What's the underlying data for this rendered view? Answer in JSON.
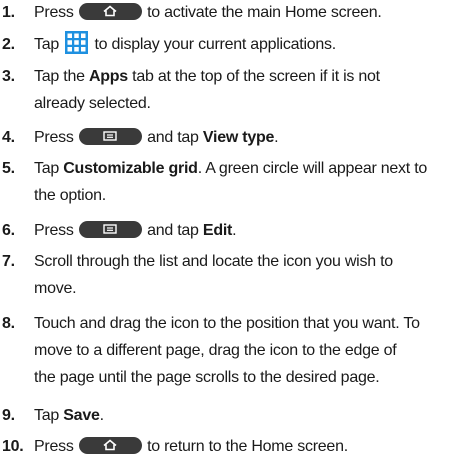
{
  "steps": [
    {
      "num": "1.",
      "pre": "Press",
      "post": "to activate the main Home screen."
    },
    {
      "num": "2.",
      "pre": "Tap",
      "post": "to display your current applications."
    },
    {
      "num": "3.",
      "pre": "Tap the",
      "bold": "Apps",
      "post": "tab at the top of the screen if it is not",
      "line2": "already selected."
    },
    {
      "num": "4.",
      "pre": "Press",
      "mid": "and tap",
      "bold": "View type",
      "post": "."
    },
    {
      "num": "5.",
      "pre": "Tap",
      "bold": "Customizable grid",
      "post": ". A green circle will appear next to",
      "line2": "the option."
    },
    {
      "num": "6.",
      "pre": "Press",
      "mid": "and tap",
      "bold": "Edit",
      "post": "."
    },
    {
      "num": "7.",
      "line1": "Scroll through the list and locate the icon you wish to",
      "line2": "move."
    },
    {
      "num": "8.",
      "line1": "Touch and drag the icon to the position that you want. To",
      "line2": "move to a different page, drag the icon to the edge of",
      "line3": "the page until the page scrolls to the desired page."
    },
    {
      "num": "9.",
      "pre": "Tap",
      "bold": "Save",
      "post": "."
    },
    {
      "num": "10.",
      "pre": "Press",
      "post": "to return to the Home screen."
    }
  ],
  "icons": {
    "home_key": "home-key-icon",
    "menu_key": "menu-key-icon",
    "apps": "apps-grid-icon",
    "key_color": "#3a3a3a",
    "apps_color": "#1e90e0"
  }
}
